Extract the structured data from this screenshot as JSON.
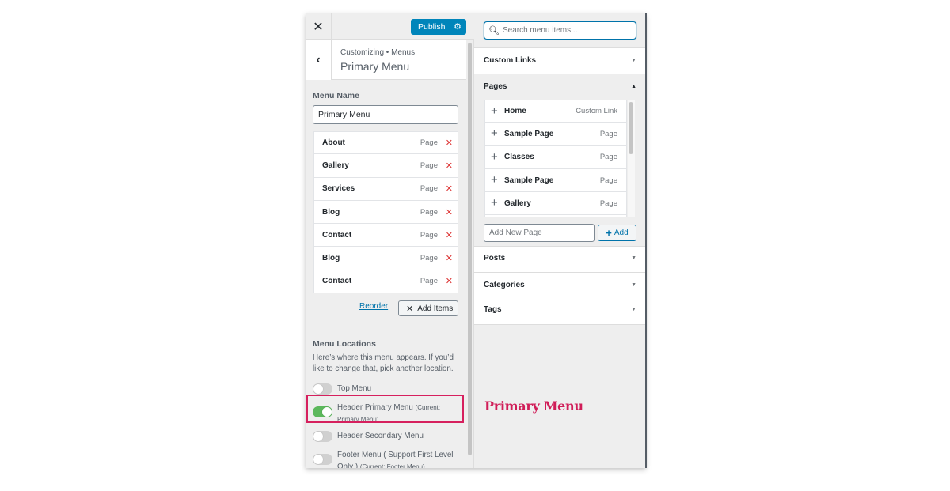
{
  "topbar": {
    "close_icon": "close-icon",
    "publish_label": "Publish",
    "settings_icon": "gear-icon"
  },
  "header": {
    "back_icon": "chevron-left-icon",
    "breadcrumb": "Customizing • Menus",
    "title": "Primary Menu"
  },
  "menu_name": {
    "label": "Menu Name",
    "value": "Primary Menu"
  },
  "menu_items": [
    {
      "title": "About",
      "type": "Page"
    },
    {
      "title": "Gallery",
      "type": "Page"
    },
    {
      "title": "Services",
      "type": "Page"
    },
    {
      "title": "Blog",
      "type": "Page"
    },
    {
      "title": "Contact",
      "type": "Page"
    },
    {
      "title": "Blog",
      "type": "Page"
    },
    {
      "title": "Contact",
      "type": "Page"
    }
  ],
  "actions": {
    "reorder_label": "Reorder",
    "add_items_label": "Add Items"
  },
  "menu_locations": {
    "title": "Menu Locations",
    "description": "Here’s where this menu appears. If you’d like to change that, pick another location.",
    "locations": [
      {
        "label": "Top Menu",
        "current": "",
        "enabled": false
      },
      {
        "label": "Header Primary Menu",
        "current": "(Current: Primary Menu)",
        "enabled": true
      },
      {
        "label": "Header Secondary Menu",
        "current": "",
        "enabled": false
      },
      {
        "label": "Footer Menu ( Support First Level Only )",
        "current": "(Current: Footer Menu)",
        "enabled": false
      }
    ]
  },
  "add_panel": {
    "search_placeholder": "Search menu items...",
    "sections": {
      "custom_links": "Custom Links",
      "pages": "Pages",
      "posts": "Posts",
      "categories": "Categories",
      "tags": "Tags"
    },
    "pages": [
      {
        "title": "Home",
        "type": "Custom Link"
      },
      {
        "title": "Sample Page",
        "type": "Page"
      },
      {
        "title": "Classes",
        "type": "Page"
      },
      {
        "title": "Sample Page",
        "type": "Page"
      },
      {
        "title": "Gallery",
        "type": "Page"
      }
    ],
    "new_page_placeholder": "Add New Page",
    "add_label": "Add"
  },
  "annotation": {
    "text": "Primary Menu",
    "color": "#d01d58"
  },
  "colors": {
    "accent": "#0085ba",
    "remove": "#dc3232",
    "toggle_on": "#5cb85c",
    "highlight": "#d6205e"
  }
}
